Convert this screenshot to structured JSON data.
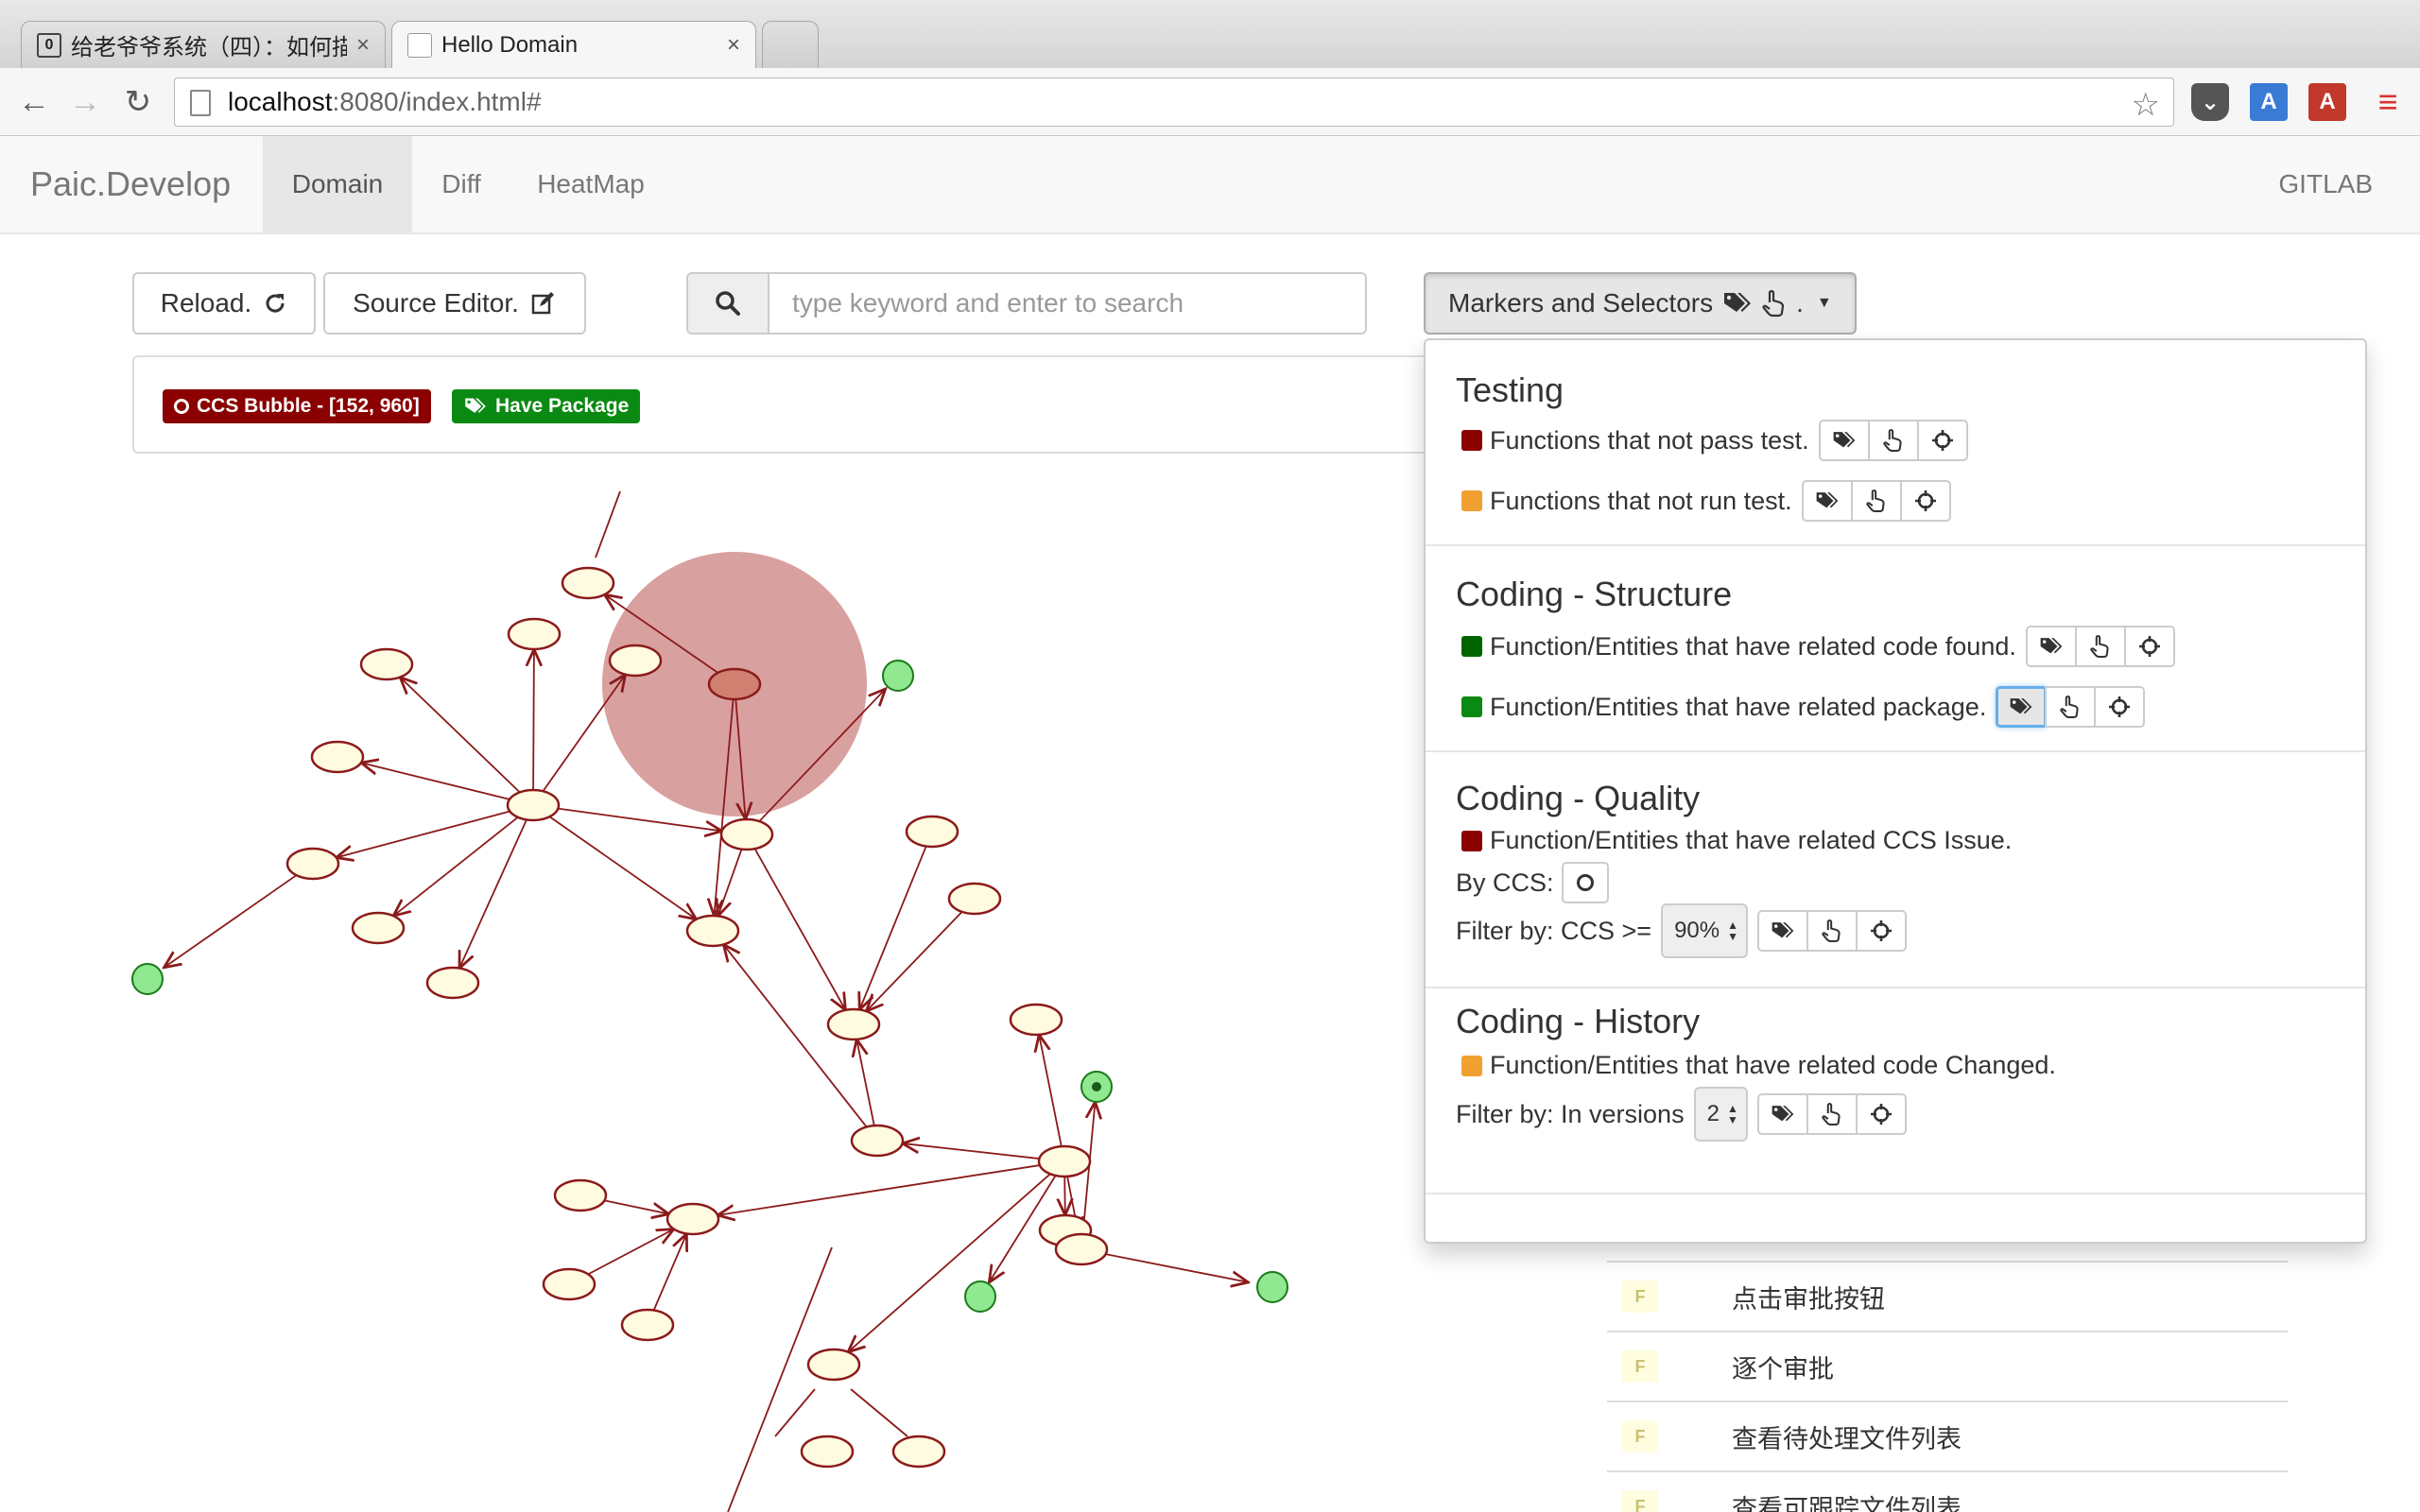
{
  "browser": {
    "tabs": [
      {
        "title": "给老爷爷系统（四）：如何描",
        "favicon": "0",
        "active": false
      },
      {
        "title": "Hello Domain",
        "favicon": "doc",
        "active": true
      }
    ],
    "url_host": "localhost",
    "url_rest": ":8080/index.html#"
  },
  "app": {
    "brand": "Paic.Develop",
    "nav": [
      "Domain",
      "Diff",
      "HeatMap"
    ],
    "active_nav": "Domain",
    "right_link": "GITLAB"
  },
  "toolbar": {
    "reload_label": "Reload.",
    "source_editor_label": "Source Editor.",
    "search_placeholder": "type keyword and enter to search",
    "markers_label": "Markers and Selectors",
    "markers_suffix": "."
  },
  "legend": {
    "ccs_label": "CCS Bubble - [152, 960]",
    "package_label": "Have Package",
    "ccs_color": "#8b0000",
    "package_color": "#0a8a12"
  },
  "markers": {
    "testing": {
      "heading": "Testing",
      "rows": [
        {
          "label": "Functions that not pass test.",
          "color": "#8b0000"
        },
        {
          "label": "Functions that not run test.",
          "color": "#f0a030"
        }
      ]
    },
    "structure": {
      "heading": "Coding - Structure",
      "rows": [
        {
          "label": "Function/Entities that have related code found.",
          "color": "#006400"
        },
        {
          "label": "Function/Entities that have related package.",
          "color": "#0a8a12"
        }
      ]
    },
    "quality": {
      "heading": "Coding - Quality",
      "row_label": "Function/Entities that have related CCS Issue.",
      "row_color": "#8b0000",
      "by_ccs_label": "By CCS:",
      "filter_label": "Filter by: CCS >=",
      "filter_value": "90%"
    },
    "history": {
      "heading": "Coding - History",
      "row_label": "Function/Entities that have related code Changed.",
      "row_color": "#f0a030",
      "filter_label": "Filter by: In versions",
      "filter_value": "2"
    }
  },
  "function_list": {
    "badge": "F",
    "items": [
      "点击审批按钮",
      "逐个审批",
      "查看待处理文件列表",
      "查看可跟踪文件列表"
    ]
  }
}
